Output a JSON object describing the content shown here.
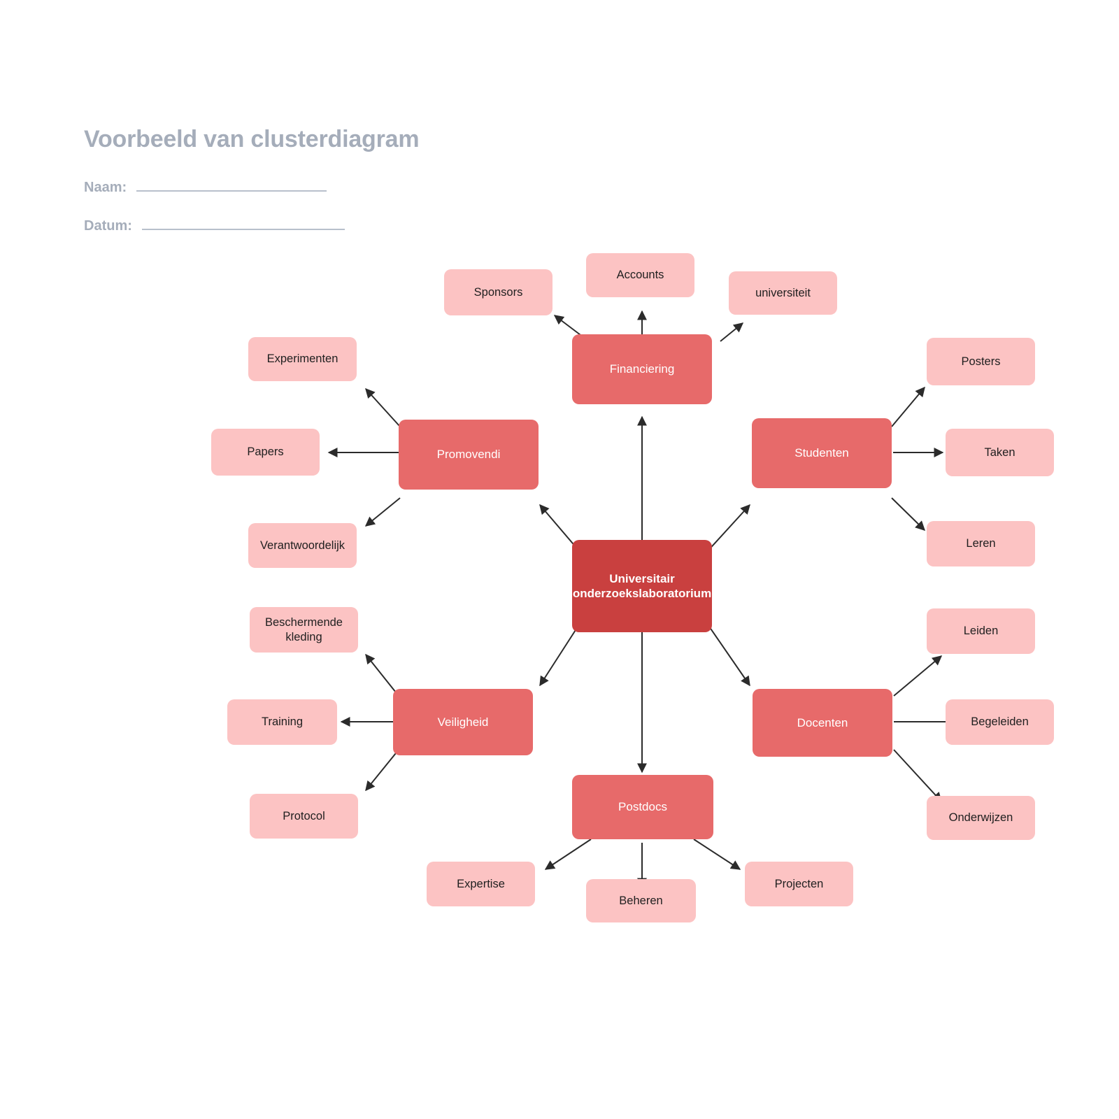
{
  "header": {
    "title": "Voorbeeld van clusterdiagram",
    "fields": [
      {
        "label": "Naam:",
        "value": ""
      },
      {
        "label": "Datum:",
        "value": ""
      }
    ]
  },
  "colors": {
    "root": "#c9403f",
    "branch": "#e76a6a",
    "leaf": "#fcc3c3",
    "title": "#a5adba",
    "edge": "#2b2b2b",
    "background": "#ffffff"
  },
  "diagram": {
    "type": "cluster-diagram",
    "root": {
      "label": "Universitair onderzoekslaboratorium"
    },
    "branches": [
      {
        "label": "Financiering",
        "leaves": [
          "Sponsors",
          "Accounts",
          "universiteit"
        ]
      },
      {
        "label": "Promovendi",
        "leaves": [
          "Experimenten",
          "Papers",
          "Verantwoordelijk"
        ]
      },
      {
        "label": "Veiligheid",
        "leaves": [
          "Beschermende kleding",
          "Training",
          "Protocol"
        ]
      },
      {
        "label": "Studenten",
        "leaves": [
          "Posters",
          "Taken",
          "Leren"
        ]
      },
      {
        "label": "Docenten",
        "leaves": [
          "Leiden",
          "Begeleiden",
          "Onderwijzen"
        ]
      },
      {
        "label": "Postdocs",
        "leaves": [
          "Expertise",
          "Beheren",
          "Projecten"
        ]
      }
    ]
  }
}
